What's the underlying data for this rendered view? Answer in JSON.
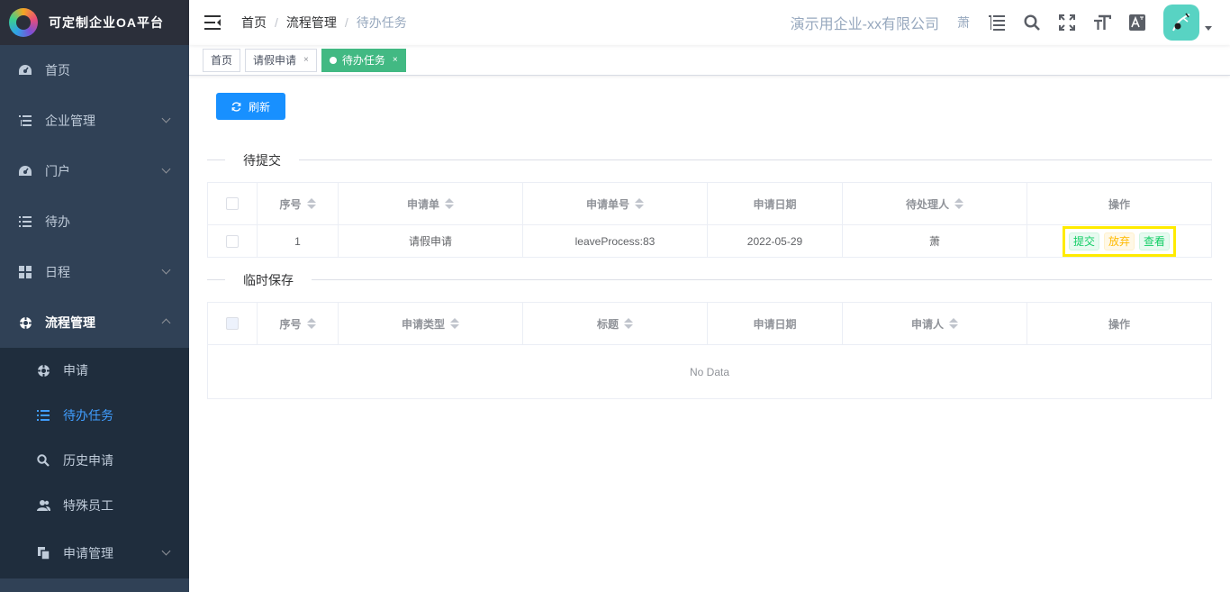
{
  "app": {
    "title": "可定制企业OA平台"
  },
  "sidebar": {
    "items": [
      {
        "label": "首页",
        "icon": "dashboard-icon"
      },
      {
        "label": "企业管理",
        "icon": "tree-list-icon"
      },
      {
        "label": "门户",
        "icon": "dashboard-icon"
      },
      {
        "label": "待办",
        "icon": "list-icon"
      },
      {
        "label": "日程",
        "icon": "grid-icon"
      },
      {
        "label": "流程管理",
        "icon": "cog-icon"
      }
    ],
    "sub_items": [
      {
        "label": "申请",
        "icon": "cog-icon"
      },
      {
        "label": "待办任务",
        "icon": "list-icon"
      },
      {
        "label": "历史申请",
        "icon": "search-icon"
      },
      {
        "label": "特殊员工",
        "icon": "peoples-icon"
      },
      {
        "label": "申请管理",
        "icon": "copy-icon"
      }
    ]
  },
  "header": {
    "breadcrumb": [
      "首页",
      "流程管理",
      "待办任务"
    ],
    "company": "演示用企业-xx有限公司",
    "user": "萧"
  },
  "tags": [
    {
      "label": "首页"
    },
    {
      "label": "请假申请",
      "close": "×"
    },
    {
      "label": "待办任务",
      "close": "×"
    }
  ],
  "refresh_label": "刷新",
  "section1": {
    "title": "待提交",
    "columns": [
      "序号",
      "申请单",
      "申请单号",
      "申请日期",
      "待处理人",
      "操作"
    ],
    "rows": [
      {
        "index": "1",
        "form": "请假申请",
        "form_no": "leaveProcess:83",
        "date": "2022-05-29",
        "handler": "萧"
      }
    ],
    "actions": {
      "submit": "提交",
      "abandon": "放弃",
      "view": "查看"
    }
  },
  "section2": {
    "title": "临时保存",
    "columns": [
      "序号",
      "申请类型",
      "标题",
      "申请日期",
      "申请人",
      "操作"
    ],
    "empty": "No Data"
  },
  "colors": {
    "sidebar_bg": "#304156",
    "submenu_bg": "#1f2d3d",
    "primary": "#1890ff",
    "tag_active": "#42b983",
    "highlight": "#ffeb00"
  }
}
